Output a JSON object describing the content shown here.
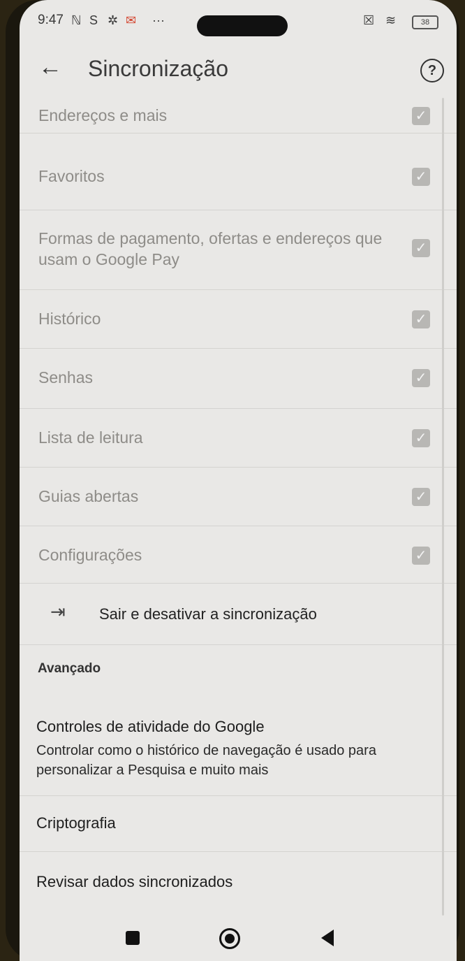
{
  "status_bar": {
    "time": "9:47",
    "battery": "38",
    "icons": [
      "nfc-icon",
      "sync-icon",
      "gear-icon",
      "mail-icon",
      "more-dots-icon",
      "sim-icon",
      "wifi-icon",
      "battery-icon"
    ]
  },
  "header": {
    "title": "Sincronização",
    "back_icon": "arrow-left-icon",
    "help_icon": "help-circle-icon",
    "help_glyph": "?"
  },
  "sync_items": [
    {
      "label": "Endereços e mais",
      "checked": true
    },
    {
      "label": "Favoritos",
      "checked": true
    },
    {
      "label": "Formas de pagamento, ofertas e endereços que usam o Google Pay",
      "checked": true
    },
    {
      "label": "Histórico",
      "checked": true
    },
    {
      "label": "Senhas",
      "checked": true
    },
    {
      "label": "Lista de leitura",
      "checked": true
    },
    {
      "label": "Guias abertas",
      "checked": true
    },
    {
      "label": "Configurações",
      "checked": true
    }
  ],
  "signout": {
    "label": "Sair e desativar a sincronização",
    "icon": "sign-out-icon"
  },
  "advanced": {
    "section_title": "Avançado",
    "activity_title": "Controles de atividade do Google",
    "activity_desc": "Controlar como o histórico de navegação é usado para personalizar a Pesquisa e muito mais",
    "encryption": "Criptografia",
    "review": "Revisar dados sincronizados"
  },
  "navbar": {
    "recent_icon": "square-icon",
    "home_icon": "circle-icon",
    "back_icon": "triangle-back-icon"
  }
}
